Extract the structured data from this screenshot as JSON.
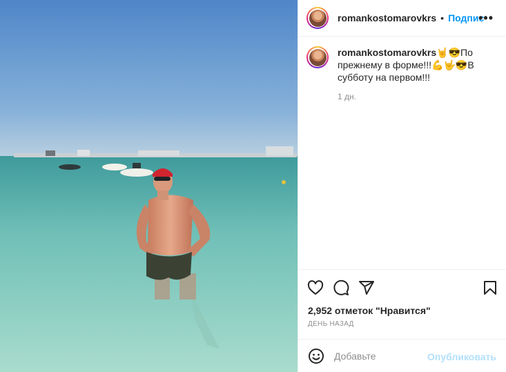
{
  "post": {
    "username": "romankostomarovkrs",
    "follow_label": "Подписаться",
    "caption": "🤘😎По прежнему в форме!!!💪🤟😎В субботу на первом!!!",
    "caption_time": "1 дн.",
    "likes": "2,952 отметок \"Нравится\"",
    "posted_ago": "ДЕНЬ НАЗАД"
  },
  "comment": {
    "placeholder": "Добавьте",
    "publish_label": "Опубликовать"
  },
  "icons": {
    "more": "more-icon",
    "like": "heart-icon",
    "comment": "comment-icon",
    "share": "send-icon",
    "save": "bookmark-icon",
    "emoji": "emoji-icon"
  },
  "colors": {
    "accent": "#0095f6",
    "publish_disabled": "#b2dffc",
    "muted": "#8e8e8e"
  }
}
